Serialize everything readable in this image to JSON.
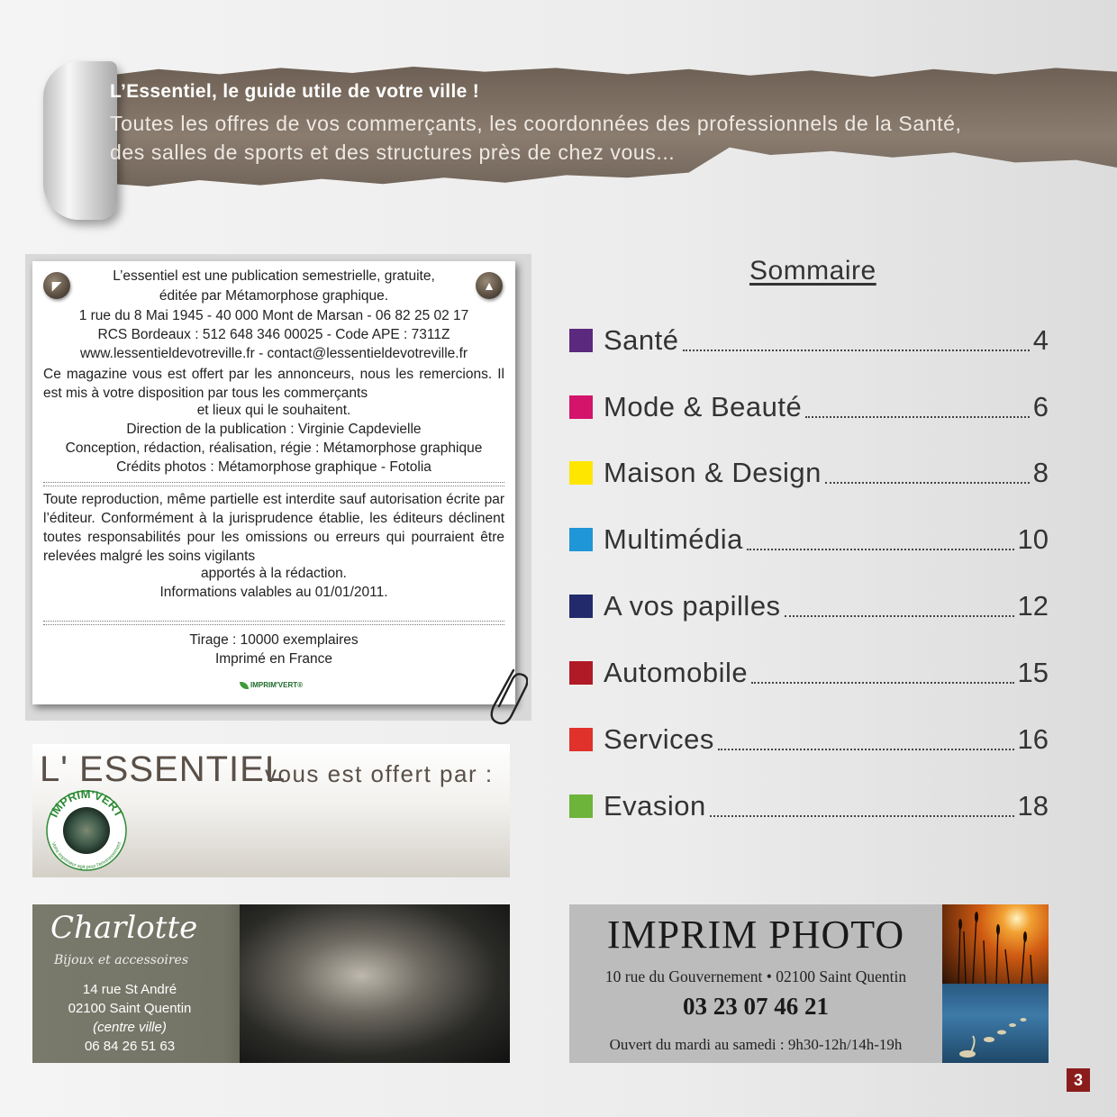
{
  "banner": {
    "title": "L’Essentiel, le guide utile de votre ville !",
    "subtitle_line1": "Toutes les offres de vos commerçants, les coordonnées des professionnels de la Santé,",
    "subtitle_line2": "des salles de sports et des structures près de chez vous..."
  },
  "info_card": {
    "line1": "L’essentiel est une publication semestrielle, gratuite,",
    "line2": "éditée par Métamorphose graphique.",
    "line3": "1 rue du 8 Mai 1945 - 40 000 Mont de Marsan - 06 82 25 02 17",
    "line4": "RCS Bordeaux : 512 648 346 00025 - Code APE : 7311Z",
    "line5": "www.lessentieldevotreville.fr - contact@lessentieldevotreville.fr",
    "para1": "Ce magazine vous est offert par les annonceurs, nous les remercions. Il est mis à votre disposition par tous les commerçants",
    "line6": "et lieux qui le souhaitent.",
    "line7": "Direction de la publication : Virginie Capdevielle",
    "line8": "Conception, rédaction, réalisation, régie : Métamorphose graphique",
    "line9": "Crédits photos : Métamorphose graphique - Fotolia",
    "para2": "Toute reproduction, même partielle est interdite sauf autorisation écrite par l’éditeur. Conformément à la jurisprudence établie, les éditeurs déclinent toutes responsabilités pour les omissions ou erreurs qui pourraient être relevées malgré les soins vigilants",
    "line10": "apportés à la rédaction.",
    "line11": "Informations valables au 01/01/2011.",
    "line12": "Tirage : 10000 exemplaires",
    "line13": "Imprimé en France",
    "logo_text": "IMPRIM'VERT®"
  },
  "offert": {
    "brand": "L' ESSENTIEL",
    "text": "vous est offert par :",
    "logo_top": "IMPRIM'VERT",
    "logo_ring": "Votre imprimeur agit pour l'environnement"
  },
  "charlotte": {
    "name": "Charlotte",
    "subtitle": "Bijoux et accessoires",
    "address1": "14 rue St André",
    "address2": "02100 Saint Quentin",
    "address3": "(centre ville)",
    "phone": "06 84 26 51 63"
  },
  "sommaire": {
    "title": "Sommaire",
    "items": [
      {
        "label": "Santé",
        "page": "4",
        "color": "#5b2a7e"
      },
      {
        "label": "Mode & Beauté",
        "page": "6",
        "color": "#d4136b"
      },
      {
        "label": "Maison & Design",
        "page": "8",
        "color": "#ffe600"
      },
      {
        "label": "Multimédia",
        "page": "10",
        "color": "#1f96d6"
      },
      {
        "label": "A vos papilles",
        "page": "12",
        "color": "#232a6b"
      },
      {
        "label": "Automobile",
        "page": "15",
        "color": "#b01a26"
      },
      {
        "label": "Services",
        "page": "16",
        "color": "#e0312a"
      },
      {
        "label": "Evasion",
        "page": "18",
        "color": "#6cb43a"
      }
    ]
  },
  "imprim_photo": {
    "name": "IMPRIM PHOTO",
    "address": "10 rue du Gouvernement • 02100 Saint Quentin",
    "phone": "03 23 07 46 21",
    "hours": "Ouvert du mardi au samedi : 9h30-12h/14h-19h"
  },
  "page_number": "3"
}
